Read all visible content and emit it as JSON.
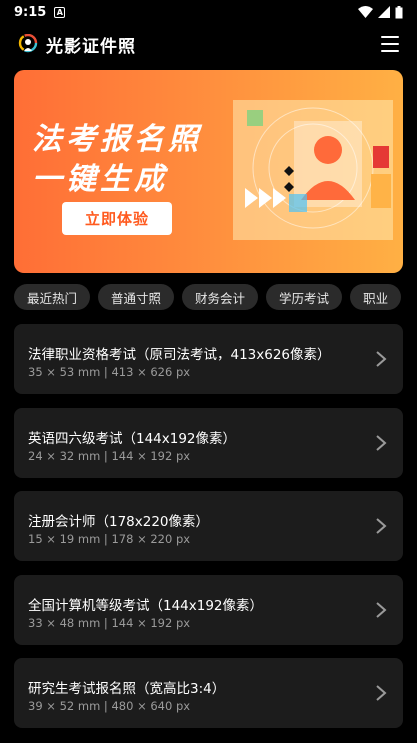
{
  "status": {
    "time": "9:15",
    "notif": "A"
  },
  "app": {
    "title": "光影证件照"
  },
  "banner": {
    "line1": "法考报名照",
    "line2": "一键生成",
    "button": "立即体验"
  },
  "chips": [
    "最近热门",
    "普通寸照",
    "财务会计",
    "学历考试",
    "职业"
  ],
  "cards": [
    {
      "title": "法律职业资格考试（原司法考试，413x626像素）",
      "sub": "35 × 53 mm | 413 × 626 px"
    },
    {
      "title": "英语四六级考试（144x192像素）",
      "sub": "24 × 32 mm | 144 × 192 px"
    },
    {
      "title": "注册会计师（178x220像素）",
      "sub": "15 × 19 mm | 178 × 220 px"
    },
    {
      "title": "全国计算机等级考试（144x192像素）",
      "sub": "33 × 48 mm | 144 × 192 px"
    },
    {
      "title": "研究生考试报名照（宽高比3:4）",
      "sub": "39 × 52 mm | 480 × 640 px"
    }
  ]
}
